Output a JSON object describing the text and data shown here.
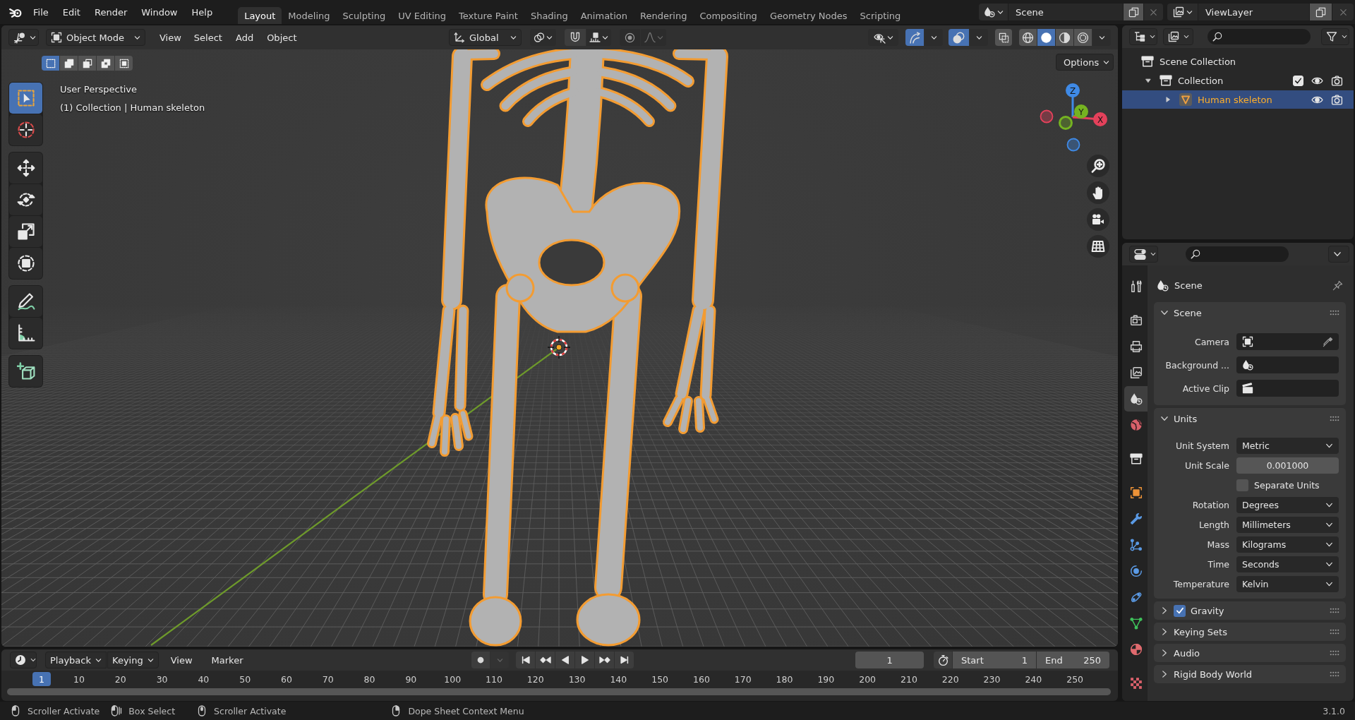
{
  "top_bar": {
    "menus": [
      "File",
      "Edit",
      "Render",
      "Window",
      "Help"
    ],
    "workspaces": [
      {
        "label": "Layout",
        "selected": true
      },
      {
        "label": "Modeling",
        "selected": false
      },
      {
        "label": "Sculpting",
        "selected": false
      },
      {
        "label": "UV Editing",
        "selected": false
      },
      {
        "label": "Texture Paint",
        "selected": false
      },
      {
        "label": "Shading",
        "selected": false
      },
      {
        "label": "Animation",
        "selected": false
      },
      {
        "label": "Rendering",
        "selected": false
      },
      {
        "label": "Compositing",
        "selected": false
      },
      {
        "label": "Geometry Nodes",
        "selected": false
      },
      {
        "label": "Scripting",
        "selected": false
      }
    ],
    "scene": "Scene",
    "view_layer": "ViewLayer"
  },
  "viewport": {
    "header": {
      "mode": "Object Mode",
      "menus": [
        "View",
        "Select",
        "Add",
        "Object"
      ],
      "orientation": "Global",
      "gizmos": true,
      "overlays": true,
      "xray": false,
      "shading": [
        {
          "kind": "wireframe",
          "selected": false
        },
        {
          "kind": "solid",
          "selected": true
        },
        {
          "kind": "material",
          "selected": false
        },
        {
          "kind": "rendered",
          "selected": false
        }
      ]
    },
    "select_modes": [
      {
        "kind": "set",
        "selected": true
      },
      {
        "kind": "extend",
        "selected": false
      },
      {
        "kind": "subtract",
        "selected": false
      },
      {
        "kind": "invert",
        "selected": false
      },
      {
        "kind": "intersect",
        "selected": false
      }
    ],
    "options": "Options",
    "tool_groups": [
      [
        {
          "kind": "select_box",
          "selected": true
        },
        {
          "kind": "cursor",
          "selected": false
        }
      ],
      [
        {
          "kind": "move",
          "selected": false
        },
        {
          "kind": "rotate",
          "selected": false
        },
        {
          "kind": "scale",
          "selected": false
        },
        {
          "kind": "transform",
          "selected": false
        }
      ],
      [
        {
          "kind": "annotate",
          "selected": false
        },
        {
          "kind": "measure",
          "selected": false
        }
      ],
      [
        {
          "kind": "add_cube",
          "selected": false
        }
      ]
    ],
    "perspective": "User Perspective",
    "object_info": "(1) Collection | Human skeleton",
    "gizmo_axes": [
      {
        "label": "Z",
        "color": "#3f8ae6"
      },
      {
        "label": "Y",
        "color": "#75b321"
      },
      {
        "label": "X",
        "color": "#e4415b"
      }
    ]
  },
  "outliner": {
    "tree": [
      {
        "kind": "scene_collection",
        "label": "Scene Collection",
        "selected": false,
        "children": [
          {
            "kind": "collection",
            "label": "Collection",
            "selected": false,
            "expanded": true,
            "checked": true,
            "children": [
              {
                "kind": "object",
                "label": "Human skeleton",
                "selected": true,
                "expanded": false
              }
            ]
          }
        ]
      }
    ]
  },
  "properties": {
    "tabs": [
      {
        "kind": "tool",
        "selected": false
      },
      {
        "kind": "render",
        "selected": false
      },
      {
        "kind": "output",
        "selected": false
      },
      {
        "kind": "view_layer",
        "selected": false
      },
      {
        "kind": "scene",
        "selected": true
      },
      {
        "kind": "world",
        "selected": false
      },
      {
        "kind": "collection",
        "selected": false
      },
      {
        "kind": "object",
        "selected": false
      },
      {
        "kind": "modifiers",
        "selected": false
      },
      {
        "kind": "particles",
        "selected": false
      },
      {
        "kind": "physics",
        "selected": false
      },
      {
        "kind": "constraints",
        "selected": false
      },
      {
        "kind": "data",
        "selected": false
      },
      {
        "kind": "material",
        "selected": false
      },
      {
        "kind": "texture",
        "selected": false
      }
    ],
    "context": "Scene",
    "panels": [
      {
        "kind": "plain",
        "title": "Scene",
        "expanded": true,
        "rows": [
          {
            "kind": "camera",
            "label": "Camera"
          },
          {
            "kind": "scene",
            "label": "Background ..."
          },
          {
            "kind": "clip",
            "label": "Active Clip"
          }
        ]
      },
      {
        "kind": "plain",
        "title": "Units",
        "expanded": true,
        "rows": [
          {
            "kind": "dropdown",
            "label": "Unit System",
            "value": "Metric"
          },
          {
            "kind": "number",
            "label": "Unit Scale",
            "value": "0.001000"
          },
          {
            "kind": "checkbox",
            "label": "Separate Units",
            "checked": false
          },
          {
            "kind": "dropdown",
            "label": "Rotation",
            "value": "Degrees"
          },
          {
            "kind": "dropdown",
            "label": "Length",
            "value": "Millimeters"
          },
          {
            "kind": "dropdown",
            "label": "Mass",
            "value": "Kilograms"
          },
          {
            "kind": "dropdown",
            "label": "Time",
            "value": "Seconds"
          },
          {
            "kind": "dropdown",
            "label": "Temperature",
            "value": "Kelvin"
          }
        ]
      },
      {
        "kind": "toggle",
        "title": "Gravity",
        "expanded": false,
        "checked": true
      },
      {
        "kind": "plain",
        "title": "Keying Sets",
        "expanded": false
      },
      {
        "kind": "plain",
        "title": "Audio",
        "expanded": false
      },
      {
        "kind": "plain",
        "title": "Rigid Body World",
        "expanded": false
      }
    ]
  },
  "timeline": {
    "menus": [
      {
        "kind": "dropdown",
        "label": "Playback"
      },
      {
        "kind": "dropdown",
        "label": "Keying"
      },
      {
        "kind": "menu",
        "label": "View"
      },
      {
        "kind": "menu",
        "label": "Marker"
      }
    ],
    "auto_keying": false,
    "current_frame": "1",
    "start_label": "Start",
    "start": "1",
    "end_label": "End",
    "end": "250",
    "playhead": "1",
    "ticks": [
      "10",
      "20",
      "30",
      "40",
      "50",
      "60",
      "70",
      "80",
      "90",
      "100",
      "110",
      "120",
      "130",
      "140",
      "150",
      "160",
      "170",
      "180",
      "190",
      "200",
      "210",
      "220",
      "230",
      "240",
      "250"
    ]
  },
  "status_bar": {
    "hints": [
      {
        "kind": "left_click",
        "label": "Scroller Activate"
      },
      {
        "kind": "drag",
        "label": "Box Select"
      },
      {
        "kind": "middle_click",
        "label": "Scroller Activate"
      },
      {
        "kind": "right_click",
        "label": "Dope Sheet Context Menu"
      }
    ],
    "version": "3.1.0"
  }
}
